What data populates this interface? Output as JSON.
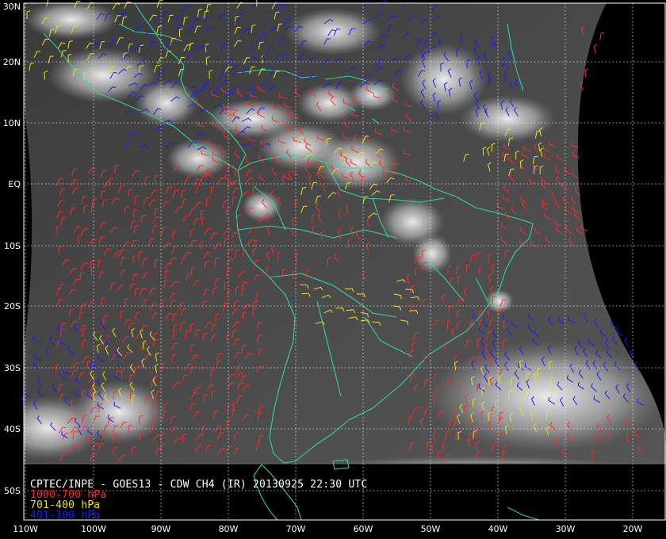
{
  "map": {
    "colors": {
      "background": "#000000",
      "coast": "#2fd49a",
      "grid": "#e8e8e8",
      "label": "#ffffff",
      "low": "#ff2a2a",
      "mid": "#e8e020",
      "high": "#1a1aff"
    },
    "lat_labels": [
      "30N",
      "20N",
      "10N",
      "EQ",
      "10S",
      "20S",
      "30S",
      "40S",
      "50S"
    ],
    "lon_labels": [
      "110W",
      "100W",
      "90W",
      "80W",
      "70W",
      "60W",
      "50W",
      "40W",
      "30W",
      "20W"
    ],
    "caption": {
      "title": "CPTEC/INPE - GOES13 - CDW CH4 (IR) 20130925 22:30 UTC",
      "legend": [
        {
          "label": "1000-700 hPa",
          "color_key": "low"
        },
        {
          "label": "701-400 hPa",
          "color_key": "mid"
        },
        {
          "label": "401-100 hPa",
          "color_key": "high"
        }
      ]
    }
  }
}
